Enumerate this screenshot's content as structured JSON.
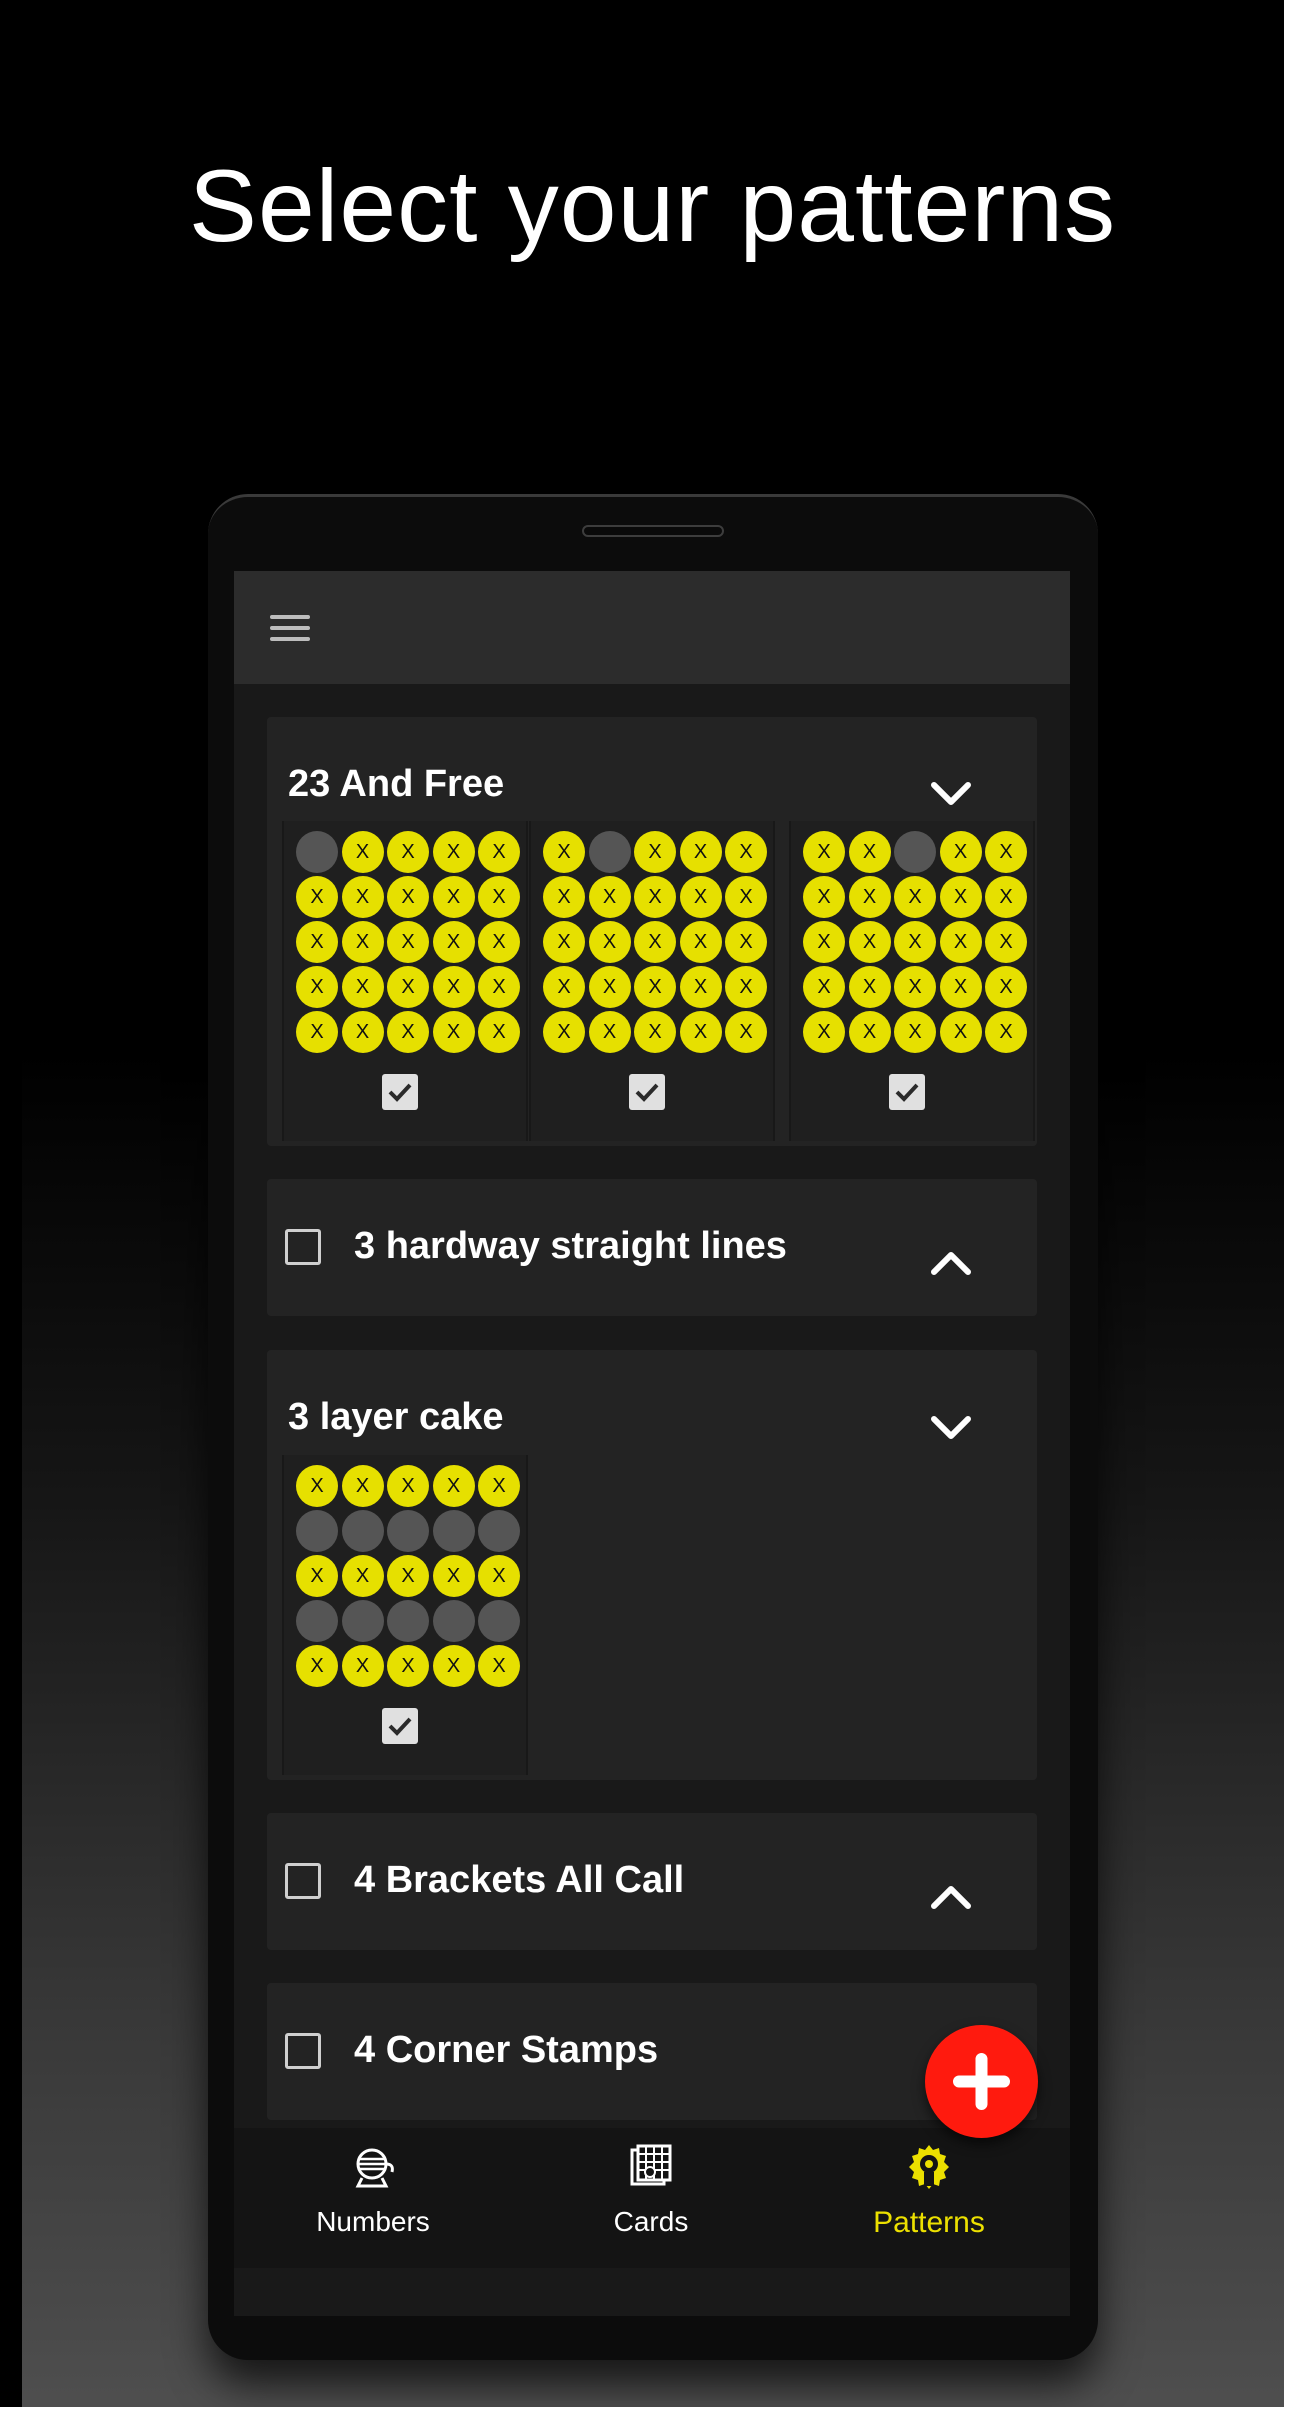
{
  "headline": "Select your patterns",
  "colors": {
    "mark": "#e6e000",
    "unmarked": "#555555",
    "fab": "#ff1a0e",
    "active_tab": "#ece000"
  },
  "icons": {
    "menu": "menu-icon",
    "expanded": "chevron-down-icon",
    "collapsed": "chevron-up-icon",
    "add": "plus-icon"
  },
  "patterns": [
    {
      "title": "23 And Free",
      "state": "expanded"
    },
    {
      "title": "3 hardway straight lines",
      "state": "collapsed"
    },
    {
      "title": "3 layer cake",
      "state": "expanded"
    },
    {
      "title": "4 Brackets All Call",
      "state": "collapsed"
    },
    {
      "title": "4 Corner Stamps",
      "state": "collapsed"
    }
  ],
  "mark_symbol": "X",
  "grids": {
    "free_a": "0111111111111111111111111",
    "free_b": "1011111111111111111111111",
    "free_c": "1101111111111111111111111",
    "layer_cake": "1111100000111110000011111"
  },
  "nav": [
    {
      "label": "Numbers",
      "icon": "bingo-cage-icon"
    },
    {
      "label": "Cards",
      "icon": "bingo-card-icon"
    },
    {
      "label": "Patterns",
      "icon": "pattern-gear-icon",
      "active": true
    }
  ]
}
